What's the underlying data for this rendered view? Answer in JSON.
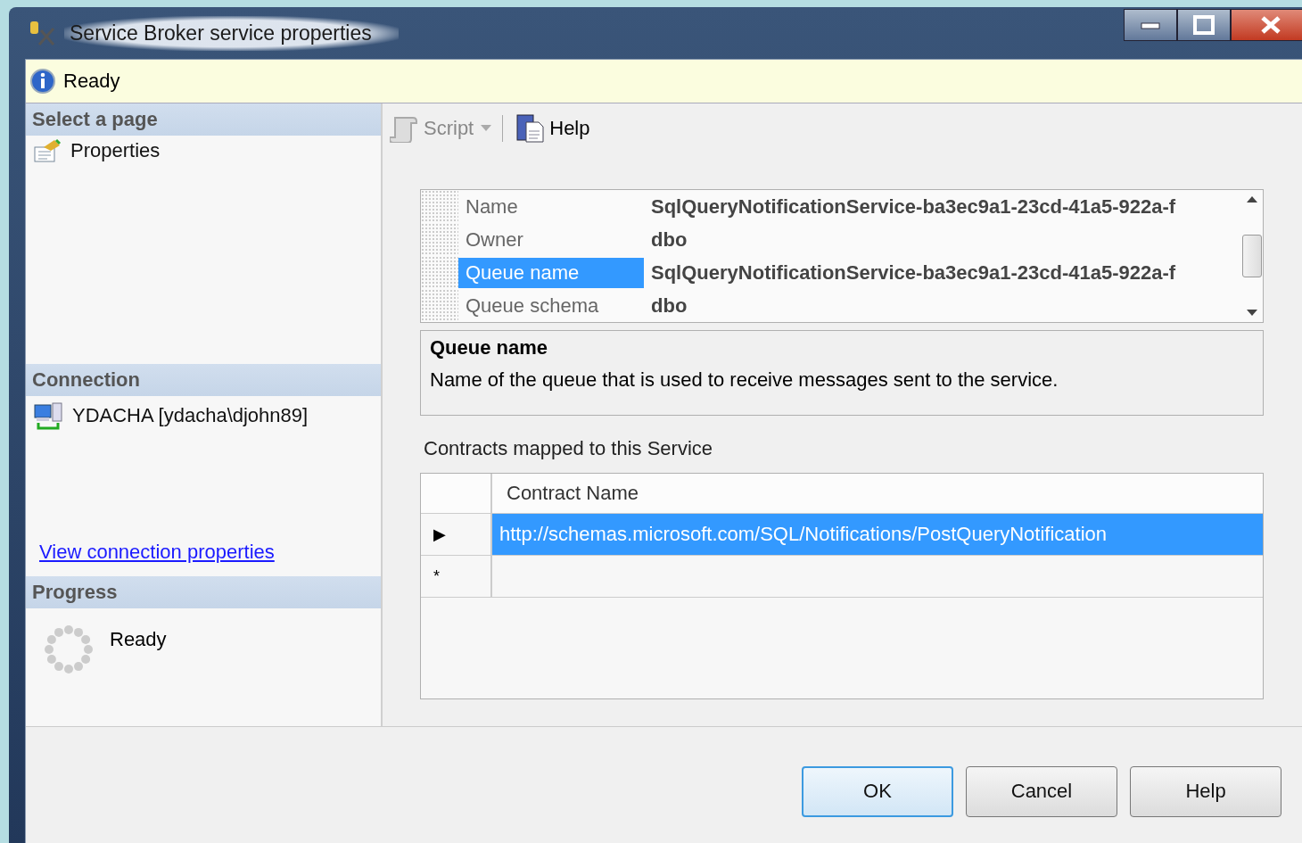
{
  "window": {
    "title": "Service Broker service properties"
  },
  "info_bar": {
    "text": "Ready"
  },
  "sidebar": {
    "sections": [
      {
        "title": "Select a page",
        "items": [
          {
            "kind": "page",
            "label": "Properties",
            "selected": false
          }
        ]
      },
      {
        "title": "Connection",
        "items": [
          {
            "kind": "server",
            "label": "YDACHA [ydacha\\djohn89]"
          },
          {
            "kind": "link",
            "label": "View connection properties"
          }
        ]
      },
      {
        "title": "Progress",
        "items": [
          {
            "kind": "progress",
            "label": "Ready"
          }
        ]
      }
    ]
  },
  "toolbar": [
    {
      "kind": "script",
      "label": "Script",
      "disabled": true
    },
    {
      "kind": "help",
      "label": "Help",
      "disabled": false
    }
  ],
  "property_grid": {
    "rows": [
      {
        "name": "Name",
        "value": "SqlQueryNotificationService-ba3ec9a1-23cd-41a5-922a-f",
        "selected": false
      },
      {
        "name": "Owner",
        "value": "dbo",
        "selected": false
      },
      {
        "name": "Queue name",
        "value": "SqlQueryNotificationService-ba3ec9a1-23cd-41a5-922a-f",
        "selected": true
      },
      {
        "name": "Queue schema",
        "value": "dbo",
        "selected": false
      }
    ]
  },
  "description": {
    "title": "Queue name",
    "text": "Name of the queue that is used to receive messages sent to the service."
  },
  "contracts": {
    "label": "Contracts mapped to this Service",
    "columns": [
      "Contract Name"
    ],
    "rows": [
      {
        "marker": "▶",
        "value": "http://schemas.microsoft.com/SQL/Notifications/PostQueryNotification",
        "selected": true
      },
      {
        "marker": "*",
        "value": "",
        "selected": false
      }
    ]
  },
  "buttons": [
    {
      "label": "OK",
      "focused": true
    },
    {
      "label": "Cancel",
      "focused": false
    },
    {
      "label": "Help",
      "focused": false
    }
  ]
}
